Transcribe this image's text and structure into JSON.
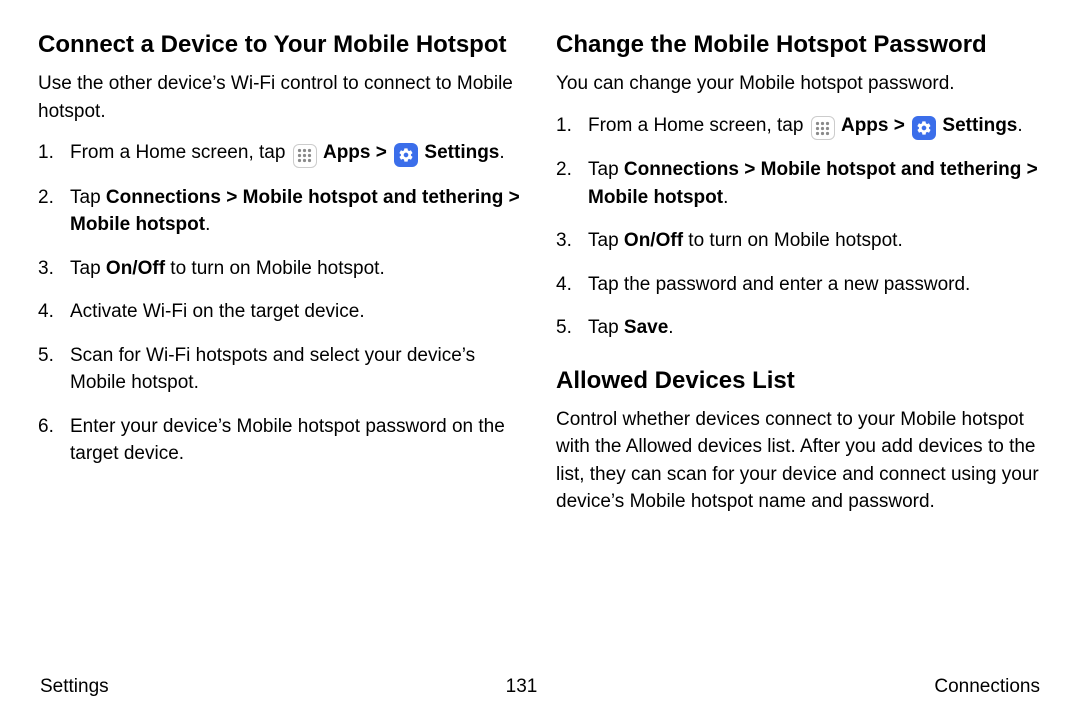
{
  "left": {
    "heading": "Connect a Device to Your Mobile Hotspot",
    "intro": "Use the other device’s Wi-Fi control to connect to Mobile hotspot.",
    "steps": {
      "s1_pre": "From a Home screen, tap ",
      "apps": "Apps",
      "sep": " > ",
      "settings": "Settings",
      "s2_a": "Tap ",
      "s2_b": "Connections > Mobile hotspot and tethering > Mobile hotspot",
      "s3_a": "Tap ",
      "s3_b": "On/Off",
      "s3_c": " to turn on Mobile hotspot.",
      "s4": "Activate Wi-Fi on the target device.",
      "s5": "Scan for Wi-Fi hotspots and select your device’s Mobile hotspot.",
      "s6": "Enter your device’s Mobile hotspot password on the target device."
    }
  },
  "right": {
    "heading1": "Change the Mobile Hotspot Password",
    "intro1": "You can change your Mobile hotspot password.",
    "steps1": {
      "s1_pre": "From a Home screen, tap ",
      "apps": "Apps",
      "sep": " > ",
      "settings": "Settings",
      "s2_a": "Tap ",
      "s2_b": "Connections > Mobile hotspot and tethering > Mobile hotspot",
      "s3_a": "Tap ",
      "s3_b": "On/Off",
      "s3_c": " to turn on Mobile hotspot.",
      "s4": "Tap the password and enter a new password.",
      "s5_a": "Tap ",
      "s5_b": "Save"
    },
    "heading2": "Allowed Devices List",
    "intro2": "Control whether devices connect to your Mobile hotspot with the Allowed devices list. After you add devices to the list, they can scan for your device and connect using your device’s Mobile hotspot name and password."
  },
  "footer": {
    "left": "Settings",
    "center": "131",
    "right": "Connections"
  }
}
